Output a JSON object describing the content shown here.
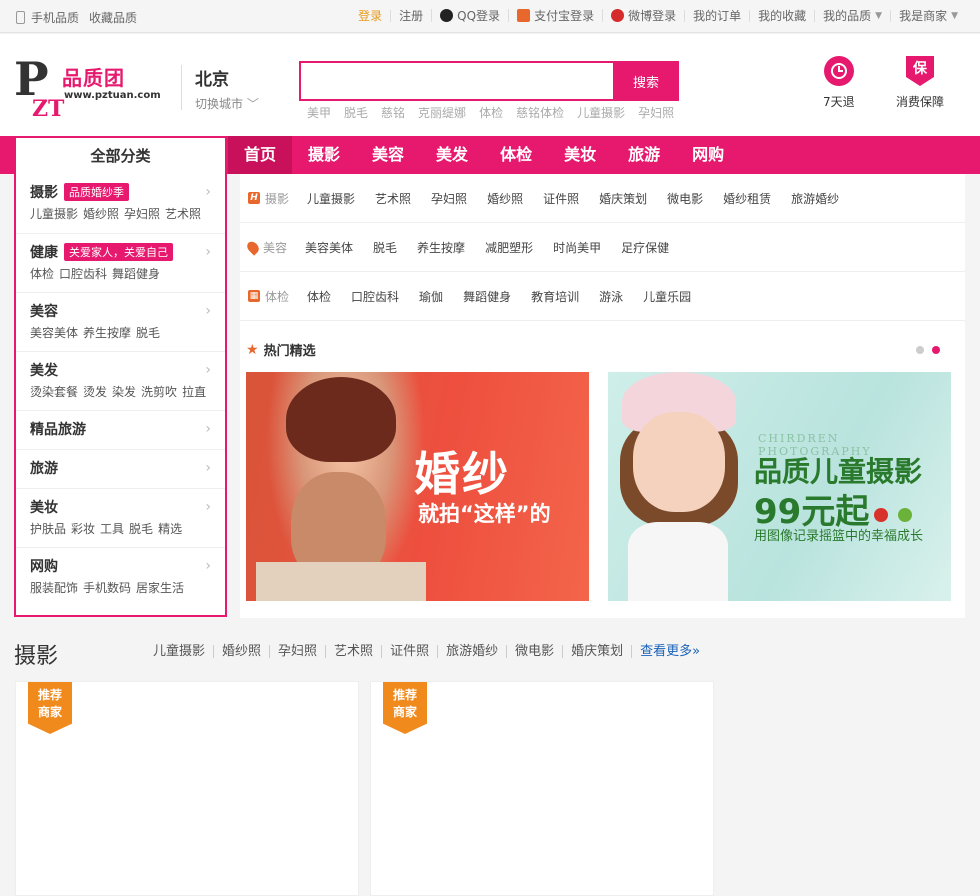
{
  "topbar": {
    "left": [
      "手机品质",
      "收藏品质"
    ],
    "login": "登录",
    "register": "注册",
    "qq": "QQ登录",
    "alipay": "支付宝登录",
    "weibo": "微博登录",
    "orders": "我的订单",
    "favorites": "我的收藏",
    "mypinzhi": "我的品质",
    "merchant": "我是商家"
  },
  "header": {
    "logo_pz": "PZT",
    "logo_brand": "品质团",
    "logo_url": "www.pztuan.com",
    "city": "北京",
    "city_switch": "切换城市",
    "search_placeholder": "",
    "search_button": "搜索",
    "hotwords": [
      "美甲",
      "脱毛",
      "慈铭",
      "克丽缇娜",
      "体检",
      "慈铭体检",
      "儿童摄影",
      "孕妇照"
    ],
    "svc1": "7天退",
    "svc2": "消费保障",
    "svc2_icon": "保"
  },
  "nav": {
    "all": "全部分类",
    "items": [
      "首页",
      "摄影",
      "美容",
      "美发",
      "体检",
      "美妆",
      "旅游",
      "网购"
    ]
  },
  "sidebar": [
    {
      "title": "摄影",
      "badge": "品质婚纱季",
      "subs": [
        "儿童摄影",
        "婚纱照",
        "孕妇照",
        "艺术照"
      ]
    },
    {
      "title": "健康",
      "badge": "关爱家人，关爱自己",
      "subs": [
        "体检",
        "口腔齿科",
        "舞蹈健身"
      ]
    },
    {
      "title": "美容",
      "badge": "",
      "subs": [
        "美容美体",
        "养生按摩",
        "脱毛"
      ]
    },
    {
      "title": "美发",
      "badge": "",
      "subs": [
        "烫染套餐",
        "烫发",
        "染发",
        "洗剪吹",
        "拉直"
      ]
    },
    {
      "title": "精品旅游",
      "badge": "",
      "subs": []
    },
    {
      "title": "旅游",
      "badge": "",
      "subs": []
    },
    {
      "title": "美妆",
      "badge": "",
      "subs": [
        "护肤品",
        "彩妆",
        "工具",
        "脱毛",
        "精选"
      ]
    },
    {
      "title": "网购",
      "badge": "",
      "subs": [
        "服装配饰",
        "手机数码",
        "居家生活"
      ]
    }
  ],
  "quick": [
    {
      "lead": "摄影",
      "items": [
        "儿童摄影",
        "艺术照",
        "孕妇照",
        "婚纱照",
        "证件照",
        "婚庆策划",
        "微电影",
        "婚纱租赁",
        "旅游婚纱"
      ]
    },
    {
      "lead": "美容",
      "items": [
        "美容美体",
        "脱毛",
        "养生按摩",
        "减肥塑形",
        "时尚美甲",
        "足疗保健"
      ]
    },
    {
      "lead": "体检",
      "items": [
        "体检",
        "口腔齿科",
        "瑜伽",
        "舞蹈健身",
        "教育培训",
        "游泳",
        "儿童乐园"
      ]
    }
  ],
  "hot": {
    "title": "热门精选"
  },
  "banner1": {
    "t1": "婚纱",
    "t2": "就拍“这样”的"
  },
  "banner2": {
    "en": "CHIRDREN PHOTOGRAPHY",
    "t1": "品质儿童摄影",
    "t2": "99元起",
    "t3": "用图像记录摇篮中的幸福成长"
  },
  "section": {
    "title": "摄影",
    "links": [
      "儿童摄影",
      "婚纱照",
      "孕妇照",
      "艺术照",
      "证件照",
      "旅游婚纱",
      "微电影",
      "婚庆策划"
    ],
    "more": "查看更多»",
    "ribbon": "推荐商家"
  },
  "colors": {
    "brand": "#e6196e",
    "orange": "#e8672c",
    "ribbon": "#f08a1d",
    "link": "#1a62b8"
  }
}
